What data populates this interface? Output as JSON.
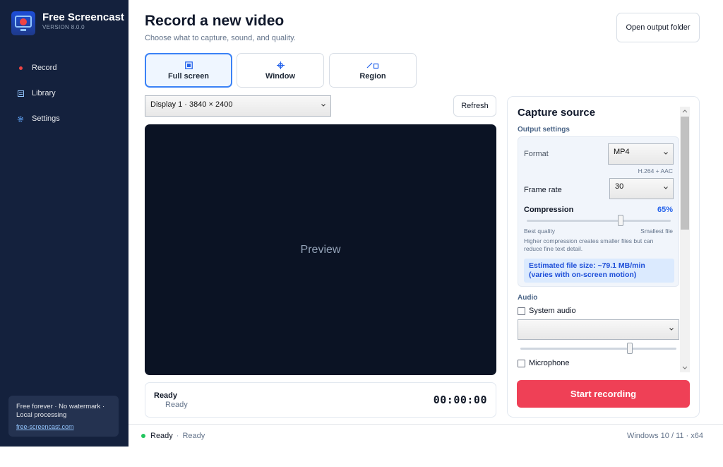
{
  "app": {
    "name": "Free Screencast",
    "version": "VERSION 8.0.0"
  },
  "sidebar": {
    "items": [
      {
        "label": "Record",
        "icon": "record-dot-icon"
      },
      {
        "label": "Library",
        "icon": "library-icon"
      },
      {
        "label": "Settings",
        "icon": "gear-icon"
      }
    ],
    "promo": {
      "text": "Free forever · No watermark · Local processing",
      "link": "free-screencast.com"
    }
  },
  "header": {
    "title": "Record a new video",
    "subtitle": "Choose what to capture, sound, and quality.",
    "open_folder_label": "Open output folder"
  },
  "modes": [
    {
      "label": "Full screen",
      "icon": "fullscreen-icon",
      "active": true
    },
    {
      "label": "Window",
      "icon": "window-target-icon",
      "active": false
    },
    {
      "label": "Region",
      "icon": "region-icon",
      "active": false
    }
  ],
  "display": {
    "selected": "Display 1  ·  3840 × 2400",
    "refresh_label": "Refresh"
  },
  "preview": {
    "label": "Preview"
  },
  "status": {
    "title": "Ready",
    "subtitle": "Ready",
    "timer": "00:00:00"
  },
  "capture": {
    "title": "Capture source",
    "output_settings_label": "Output settings",
    "format": {
      "label": "Format",
      "value": "MP4",
      "hint": "H.264 + AAC"
    },
    "frame_rate": {
      "label": "Frame rate",
      "value": "30"
    },
    "compression": {
      "label": "Compression",
      "value": "65%",
      "level": 0.65,
      "min_label": "Best quality",
      "max_label": "Smallest file",
      "hint": "Higher compression creates smaller files but can reduce fine text detail."
    },
    "estimate": {
      "line1": "Estimated file size: ~79.1 MB/min",
      "line2": "(varies with on-screen motion)"
    },
    "audio": {
      "label": "Audio",
      "system_audio_label": "System audio",
      "system_audio_checked": false,
      "system_audio_device": "",
      "system_volume_level": 0.7,
      "microphone_label": "Microphone",
      "microphone_checked": false
    },
    "start_label": "Start recording"
  },
  "footer": {
    "status": "Ready",
    "status_detail": "Ready",
    "platform": "Windows 10 / 11  ·  x64"
  },
  "colors": {
    "accent": "#3b82f6",
    "danger": "#ef4056",
    "sidebar_bg": "#14213d",
    "preview_bg": "#0b1324"
  }
}
